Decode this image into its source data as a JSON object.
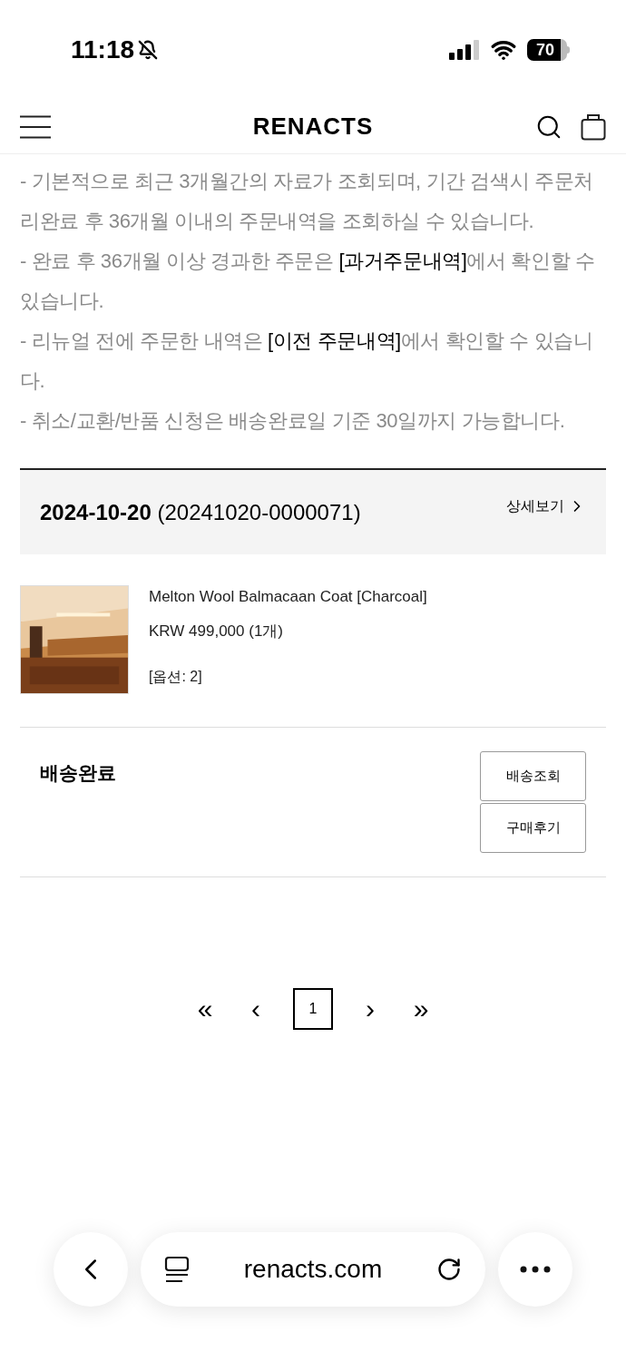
{
  "status_bar": {
    "time": "11:18",
    "battery": "70"
  },
  "header": {
    "logo": "RENACTS"
  },
  "notices": [
    [
      {
        "text": "- 기본적으로 최근 3개월간의 자료가 조회되며, 기간 검색시 주문처리완료 후 36개월 이내의 주문내역을 조회하실 수 있습니다.",
        "emphasis": false
      }
    ],
    [
      {
        "text": "- 완료 후 36개월 이상 경과한 주문은 ",
        "emphasis": false
      },
      {
        "text": "[과거주문내역]",
        "emphasis": true
      },
      {
        "text": "에서 확인할 수 있습니다.",
        "emphasis": false
      }
    ],
    [
      {
        "text": "- 리뉴얼 전에 주문한 내역은 ",
        "emphasis": false
      },
      {
        "text": "[이전 주문내역]",
        "emphasis": true
      },
      {
        "text": "에서 확인할 수 있습니다.",
        "emphasis": false
      }
    ],
    [
      {
        "text": "- 취소/교환/반품 신청은 배송완료일 기준 30일까지 가능합니다.",
        "emphasis": false
      }
    ]
  ],
  "order": {
    "date": "2024-10-20",
    "number": "(20241020-0000071)",
    "detail_link": "상세보기",
    "product": {
      "kind": "picture",
      "name": "Melton Wool Balmacaan Coat [Charcoal]",
      "price": "KRW 499,000 (1개)",
      "option": "[옵션: 2]"
    },
    "status": "배송완료",
    "buttons": [
      "배송조회",
      "구매후기"
    ]
  },
  "pagination": {
    "first": "«",
    "prev": "‹",
    "pages": [
      {
        "label": "1",
        "selected": true
      }
    ],
    "next": "›",
    "last": "»"
  },
  "browser_bar": {
    "url": "renacts.com"
  }
}
